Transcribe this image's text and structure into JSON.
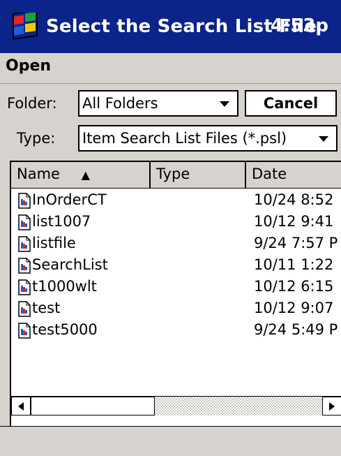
{
  "titlebar": {
    "title": "Select the Search List File",
    "time": "4:53p",
    "icon": "windows-flag-icon"
  },
  "menubar": {
    "menu_label": "Open"
  },
  "form": {
    "folder_label": "Folder:",
    "folder_value": "All Folders",
    "cancel_label": "Cancel",
    "type_label": "Type:",
    "type_value": "Item Search List Files (*.psl)"
  },
  "list": {
    "columns": {
      "name": "Name",
      "sort_indicator": "▲",
      "type": "Type",
      "date": "Date"
    },
    "files": [
      {
        "name": "InOrderCT",
        "date": "10/24 8:52"
      },
      {
        "name": "list1007",
        "date": "10/12 9:41"
      },
      {
        "name": "listfile",
        "date": "9/24 7:57 P"
      },
      {
        "name": "SearchList",
        "date": "10/11 1:22"
      },
      {
        "name": "t1000wlt",
        "date": "10/12 6:15"
      },
      {
        "name": "test",
        "date": "10/12 9:07"
      },
      {
        "name": "test5000",
        "date": "9/24 5:49 P"
      }
    ]
  },
  "colors": {
    "titlebar_bg": "#0b248a",
    "chrome_bg": "#d6d3ce",
    "list_bg": "#ffffff"
  }
}
